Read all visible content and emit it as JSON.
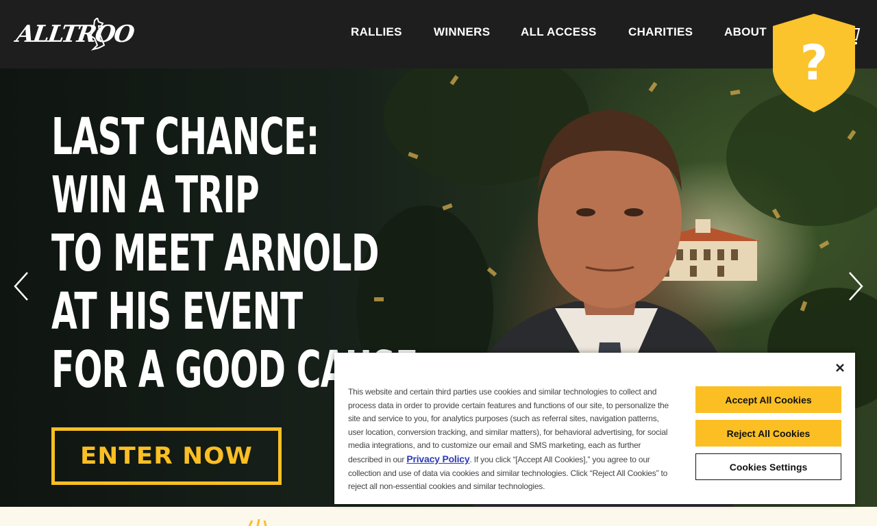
{
  "header": {
    "logo_text": "ALLTROO",
    "nav": [
      {
        "label": "RALLIES"
      },
      {
        "label": "WINNERS"
      },
      {
        "label": "ALL ACCESS"
      },
      {
        "label": "CHARITIES"
      },
      {
        "label": "ABOUT"
      }
    ],
    "icons": {
      "cart": "cart-icon",
      "help": "question-shield-icon"
    }
  },
  "hero": {
    "headline_lines": [
      "LAST CHANCE:",
      "WIN A TRIP",
      "TO MEET ARNOLD",
      "AT HIS EVENT",
      "FOR A GOOD CAUSE"
    ],
    "cta_label": "ENTER NOW",
    "icons": {
      "prev": "chevron-left-icon",
      "next": "chevron-right-icon"
    }
  },
  "cookie_banner": {
    "text_before_link": "This website and certain third parties use cookies and similar technologies to collect and process data in order to provide certain features and functions of our site, to personalize the site and service to you, for analytics purposes (such as referral sites, navigation patterns, user location, conversion tracking, and similar matters), for behavioral advertising, for social media integrations, and to customize our email and SMS marketing, each as further described in our ",
    "link_label": "Privacy Policy",
    "text_after_link": ". If you click “[Accept All Cookies],” you agree to our collection and use of data via cookies and similar technologies. Click “Reject All Cookies” to reject all non-essential cookies and similar technologies.",
    "accept_label": "Accept All Cookies",
    "reject_label": "Reject All Cookies",
    "settings_label": "Cookies Settings",
    "close_icon": "close-icon"
  },
  "colors": {
    "header_bg": "#1e1e1e",
    "accent": "#fbbf24",
    "link": "#2d3bb8",
    "page_bg": "#fdf8ec"
  }
}
